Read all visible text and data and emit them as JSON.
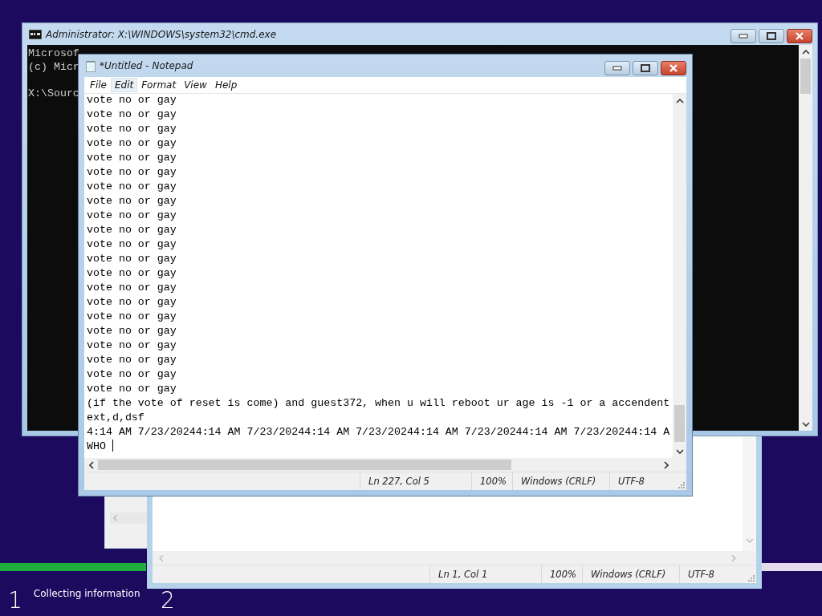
{
  "setup": {
    "progress": {
      "level": 0.178
    },
    "steps": [
      {
        "number": "1",
        "label": "Collecting information"
      },
      {
        "number": "2"
      }
    ]
  },
  "cmd": {
    "title": "Administrator: X:\\WINDOWS\\system32\\cmd.exe",
    "lines": [
      "Microsof",
      "(c) Micr",
      "X:\\Sourc"
    ]
  },
  "back_notepad": {
    "status": [
      "Ln 1, Col 1",
      "100%",
      "Windows (CRLF)",
      "UTF-8"
    ]
  },
  "notepad": {
    "title": "*Untitled - Notepad",
    "menu": [
      {
        "label": "File",
        "selected": false
      },
      {
        "label": "Edit",
        "selected": true
      },
      {
        "label": "Format",
        "selected": false
      },
      {
        "label": "View",
        "selected": false
      },
      {
        "label": "Help",
        "selected": false
      }
    ],
    "lines": [
      "vote no or gay",
      "vote no or gay",
      "vote no or gay",
      "vote no or gay",
      "vote no or gay",
      "vote no or gay",
      "vote no or gay",
      "vote no or gay",
      "vote no or gay",
      "vote no or gay",
      "vote no or gay",
      "vote no or gay",
      "vote no or gay",
      "vote no or gay",
      "vote no or gay",
      "vote no or gay",
      "vote no or gay",
      "vote no or gay",
      "vote no or gay",
      "vote no or gay",
      "vote no or gay",
      "(if the vote of reset is come) and guest372, when u will reboot ur age is -1 or a accendent",
      "ext,d,dsf",
      "4:14 AM 7/23/20244:14 AM 7/23/20244:14 AM 7/23/20244:14 AM 7/23/20244:14 AM 7/23/20244:14 A",
      "WHO "
    ],
    "status": [
      "Ln 227, Col 5",
      "100%",
      "Windows (CRLF)",
      "UTF-8"
    ]
  }
}
